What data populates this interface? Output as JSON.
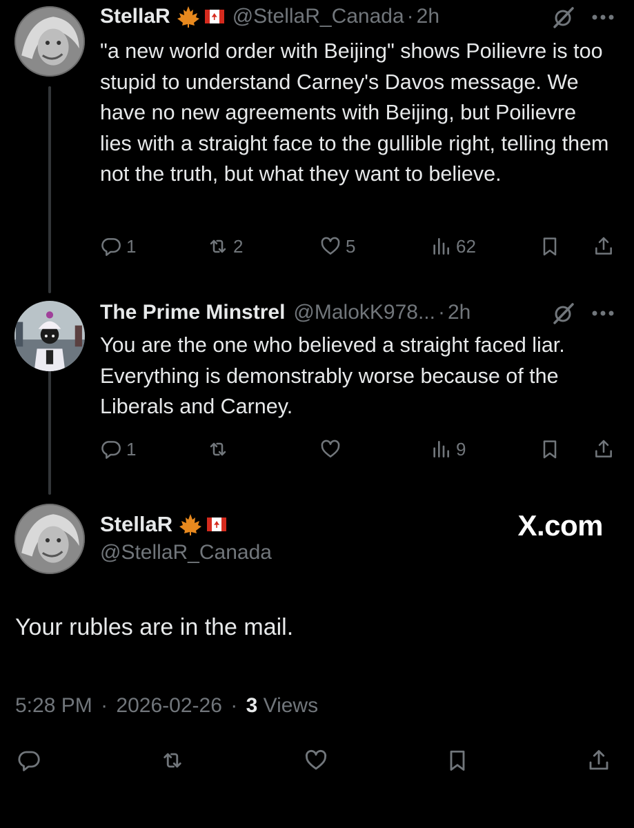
{
  "tweets": [
    {
      "name": "StellaR",
      "handle": "@StellaR_Canada",
      "time": "2h",
      "text": "\"a new world order with Beijing\" shows Poilievre is too stupid to understand Carney's Davos message. We have no new agreements with Beijing, but Poilievre lies with a straight face to the gullible right, telling them not the truth, but what they want to believe.",
      "replies": "1",
      "reposts": "2",
      "likes": "5",
      "views": "62"
    },
    {
      "name": "The Prime Minstrel",
      "handle": "@MalokK978...",
      "time": "2h",
      "text": "You are the one who believed a straight faced liar. Everything is demonstrably worse because of the Liberals and Carney.",
      "replies": "1",
      "reposts": "",
      "likes": "",
      "views": "9"
    }
  ],
  "main_post": {
    "name": "StellaR",
    "handle": "@StellaR_Canada",
    "text": "Your rubles are in the mail.",
    "time": "5:28 PM",
    "date": "2026-02-26",
    "views_count": "3",
    "views_label": "Views"
  },
  "watermark": "X.com",
  "separator": "·",
  "colors": {
    "background": "#000000",
    "text": "#e7e9ea",
    "muted": "#71767b",
    "thread_line": "#333639"
  },
  "icons": [
    "maple-leaf-icon",
    "canada-flag-icon",
    "grok-icon",
    "more-icon",
    "reply-icon",
    "repost-icon",
    "like-icon",
    "views-icon",
    "bookmark-icon",
    "share-icon"
  ]
}
